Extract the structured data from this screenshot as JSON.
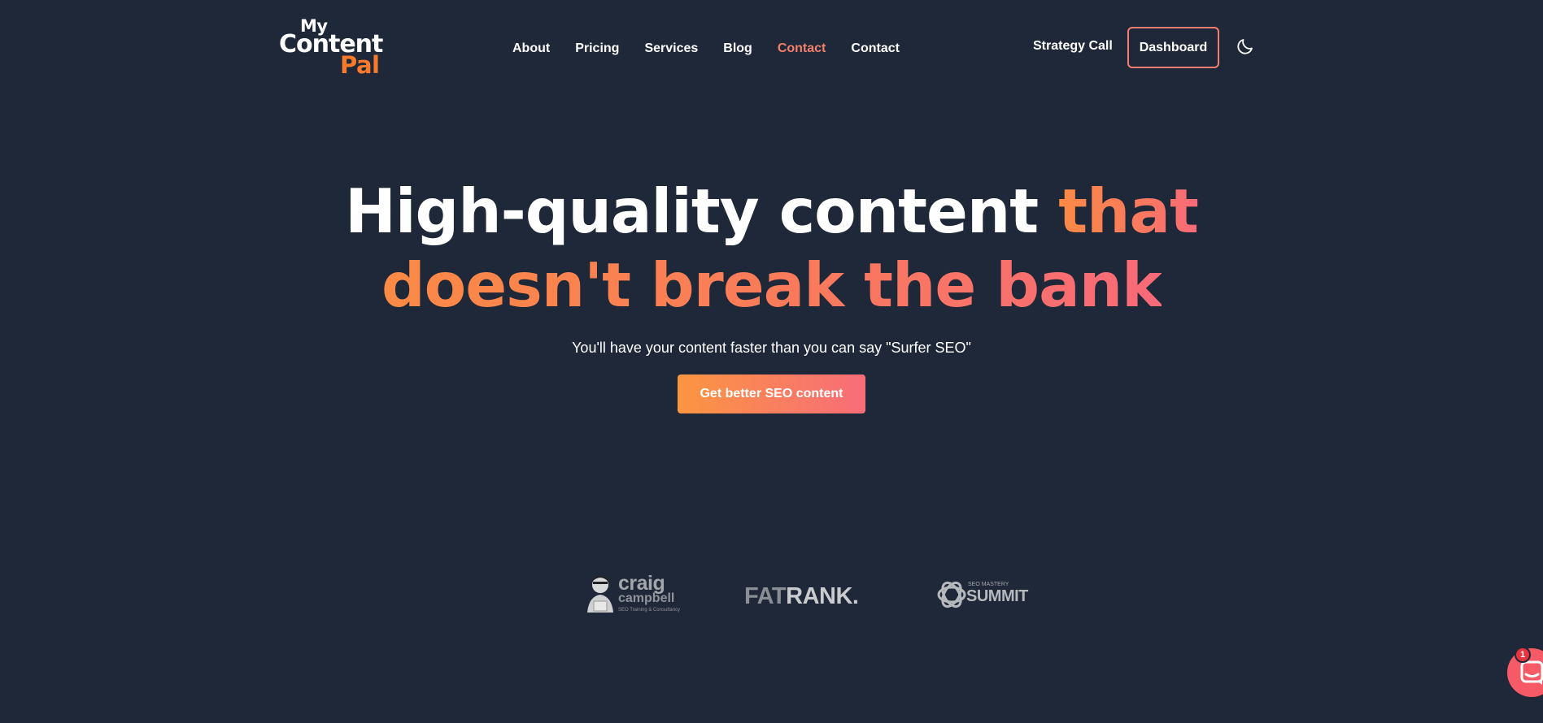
{
  "logo": {
    "line1": "My",
    "line2": "Content",
    "line3": "Pal"
  },
  "nav": {
    "items": [
      {
        "label": "About"
      },
      {
        "label": "Pricing"
      },
      {
        "label": "Services"
      },
      {
        "label": "Blog"
      },
      {
        "label": "Contact",
        "active": true
      },
      {
        "label": "Contact"
      }
    ],
    "strategy_label": "Strategy Call",
    "dashboard_label": "Dashboard",
    "theme_toggle_icon": "moon-icon"
  },
  "hero": {
    "title_white": "High-quality content ",
    "title_accent_1": "that",
    "title_accent_2": "doesn't break the bank",
    "subtitle": "You'll have your content faster than you can say \"Surfer SEO\"",
    "cta_label": "Get better SEO content"
  },
  "brands": {
    "craig": {
      "name1": "craig",
      "name2": "campbell",
      "tagline": "SEO Training & Consultancy"
    },
    "fatrank": {
      "fat": "FAT",
      "rank": "RANK."
    },
    "summit": {
      "small": "SEO MASTERY",
      "big": "SUMMIT"
    }
  },
  "chat": {
    "icon": "chat-bubble-icon",
    "badge_count": "1"
  },
  "colors": {
    "background": "#1f2838",
    "accent": "#f97a2a",
    "gradient_start": "#fb8a45",
    "gradient_end": "#f86a78"
  }
}
